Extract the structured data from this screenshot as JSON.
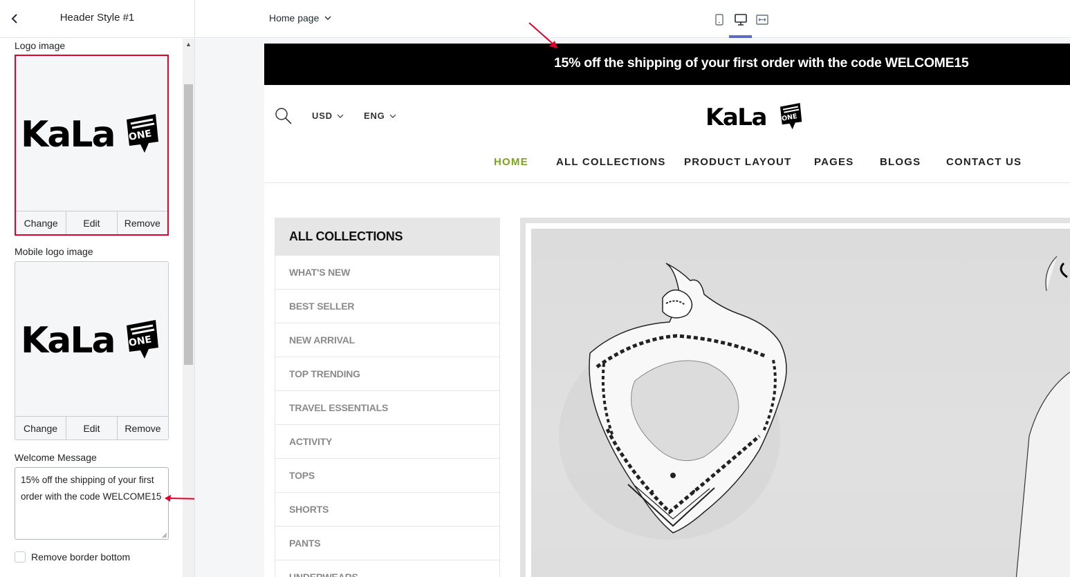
{
  "sidebar": {
    "title": "Header Style #1",
    "logo_image": {
      "label": "Logo image",
      "logo_text": "KaLa",
      "badge_text": "ONE",
      "actions": {
        "change": "Change",
        "edit": "Edit",
        "remove": "Remove"
      }
    },
    "mobile_logo_image": {
      "label": "Mobile logo image",
      "logo_text": "KaLa",
      "badge_text": "ONE",
      "actions": {
        "change": "Change",
        "edit": "Edit",
        "remove": "Remove"
      }
    },
    "welcome_message": {
      "label": "Welcome Message",
      "value": "15% off the shipping of your first order with the code WELCOME15"
    },
    "remove_border_bottom": {
      "label": "Remove border bottom",
      "checked": false
    }
  },
  "topbar": {
    "page_selector": "Home page",
    "devices": [
      "mobile-icon",
      "desktop-icon",
      "fullscreen-icon"
    ],
    "active_device": "desktop"
  },
  "preview": {
    "announcement": "15% off the shipping of your first order with the code WELCOME15",
    "currency": "USD",
    "language": "ENG",
    "logo_text": "KaLa",
    "logo_badge": "ONE",
    "nav": [
      "HOME",
      "ALL COLLECTIONS",
      "PRODUCT LAYOUT",
      "PAGES",
      "BLOGS",
      "CONTACT US"
    ],
    "active_nav": "HOME",
    "collections_title": "ALL COLLECTIONS",
    "collections": [
      "WHAT'S NEW",
      "BEST SELLER",
      "NEW ARRIVAL",
      "TOP TRENDING",
      "TRAVEL ESSENTIALS",
      "ACTIVITY",
      "TOPS",
      "SHORTS",
      "PANTS",
      "UNDERWEARS"
    ]
  },
  "colors": {
    "highlight": "#e4002b",
    "active_nav": "#7aa51a",
    "announcement_bg": "#000000",
    "device_active": "#5c6ac4"
  }
}
